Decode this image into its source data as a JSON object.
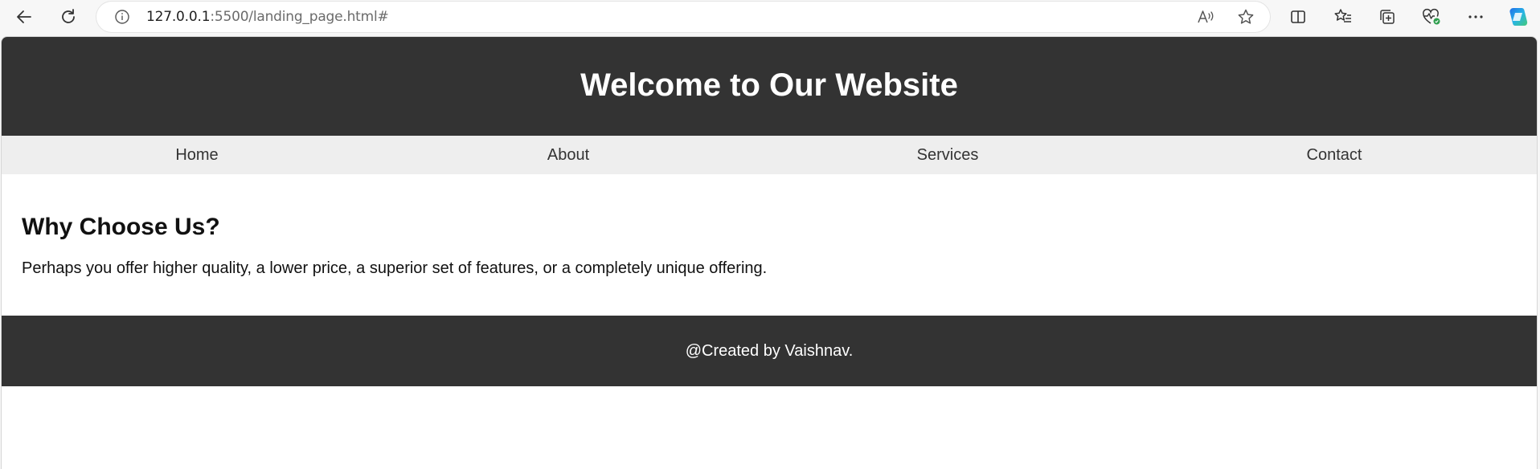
{
  "browser": {
    "address": {
      "host": "127.0.0.1",
      "path": ":5500/landing_page.html#"
    },
    "icons": {
      "back": "back-arrow-icon",
      "refresh": "refresh-icon",
      "info": "info-icon",
      "read_aloud": "read-aloud-icon",
      "favorite": "star-icon",
      "split_screen": "split-screen-icon",
      "favorites": "favorites-list-icon",
      "collections": "collections-icon",
      "browser_essentials": "heart-pulse-icon",
      "menu": "more-dots-icon",
      "copilot": "copilot-icon"
    },
    "colors": {
      "toolbar_bg": "#f7f7f7",
      "address_bg": "#ffffff"
    }
  },
  "page": {
    "header": {
      "title": "Welcome to Our Website"
    },
    "nav": {
      "items": [
        {
          "label": "Home"
        },
        {
          "label": "About"
        },
        {
          "label": "Services"
        },
        {
          "label": "Contact"
        }
      ]
    },
    "section": {
      "heading": "Why Choose Us?",
      "body": "Perhaps you offer higher quality, a lower price, a superior set of features, or a completely unique offering."
    },
    "footer": {
      "text": "@Created by Vaishnav."
    },
    "colors": {
      "header_bg": "#333333",
      "nav_bg": "#eeeeee",
      "footer_bg": "#333333",
      "text_light": "#ffffff",
      "text_dark": "#111111"
    }
  }
}
